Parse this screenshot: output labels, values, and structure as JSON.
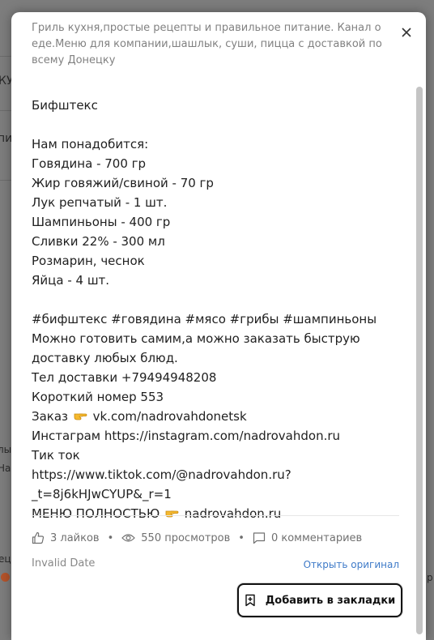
{
  "background": {
    "fragments": [
      "КУ",
      "пи",
      "лы",
      "На",
      "ец",
      "р"
    ]
  },
  "modal": {
    "channel_description": "Гриль кухня,простые рецепты и правильное питание. Канал о еде.Меню для компании,шашлык, суши, пицца с доставкой по всему Донецку",
    "post_lines": [
      "Бифштекс",
      "",
      "Нам понадобится:",
      "Говядина - 700 гр",
      "Жир говяжий/свиной - 70 гр",
      "Лук репчатый - 1 шт.",
      "Шампиньоны - 400 гр",
      "Сливки 22% - 300 мл",
      "Розмарин, чеснок",
      "Яйца - 4 шт.",
      "",
      "#бифштекс #говядина #мясо #грибы #шампиньоны",
      "Можно готовить самим,а можно заказать быструю доставку любых блюд.",
      "Тел доставки +79494948208",
      "Короткий номер 553"
    ],
    "order_label": "Заказ",
    "order_link": "vk.com/nadrovahdonetsk",
    "instagram_line": "Инстаграм https://instagram.com/nadrovahdon.ru",
    "tiktok_line": "Тик ток https://www.tiktok.com/@nadrovahdon.ru?_t=8j6kHJwCYUP&_r=1",
    "menu_label": "МЕНЮ ПОЛНОСТЬЮ",
    "menu_link": "nadrovahdon.ru",
    "stats": {
      "likes": "3 лайков",
      "views": "550 просмотров",
      "comments": "0 комментариев"
    },
    "date": "Invalid Date",
    "open_original": "Открыть оригинал",
    "bookmark_button": "Добавить в закладки",
    "colors": {
      "link": "#3f7bc8",
      "text": "#1f1f1f",
      "muted": "#818181"
    }
  }
}
